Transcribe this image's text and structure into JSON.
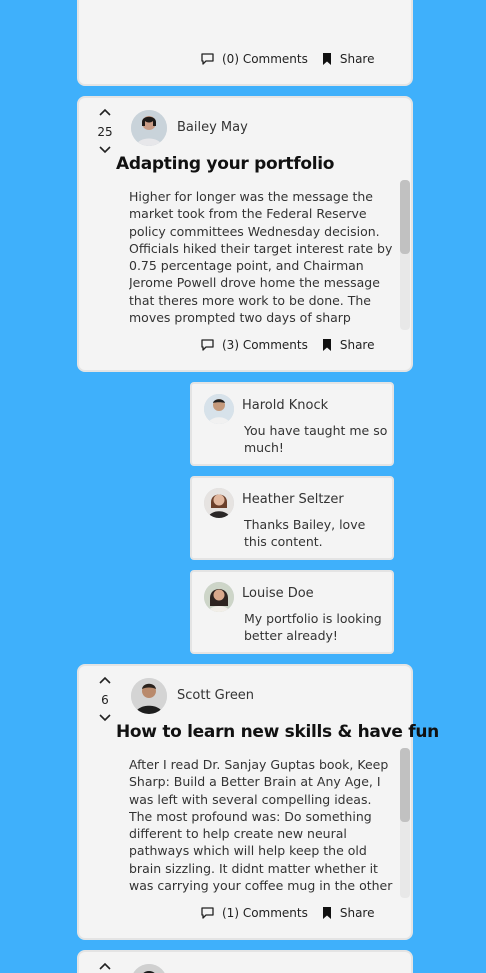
{
  "posts": [
    {
      "comments_label": "(0) Comments",
      "share_label": "Share"
    },
    {
      "score": "25",
      "author": "Bailey May",
      "title": "Adapting your portfolio",
      "body": "Higher for longer was the message the market took from the Federal Reserve policy committees Wednesday decision. Officials hiked their target interest rate by 0.75 percentage point, and Chairman Jerome Powell drove home the message that theres more work to be done. The moves prompted two days of sharp",
      "comments_label": "(3) Comments",
      "share_label": "Share"
    },
    {
      "score": "6",
      "author": "Scott Green",
      "title": "How to learn new skills & have fun",
      "body": "After I read Dr. Sanjay Guptas book, Keep Sharp: Build a Better Brain at Any Age, I was left with several compelling ideas. The most profound was: Do something different to help create new neural pathways which will help keep the old brain sizzling. It didnt matter whether it was carrying your coffee mug in the other",
      "comments_label": "(1) Comments",
      "share_label": "Share"
    }
  ],
  "comments": [
    {
      "author": "Harold Knock",
      "text": "You have taught me so much!"
    },
    {
      "author": "Heather Seltzer",
      "text": "Thanks Bailey, love this content."
    },
    {
      "author": "Louise Doe",
      "text": "My portfolio is looking better already!"
    }
  ],
  "icons": {
    "upvote": "chevron-up-icon",
    "downvote": "chevron-down-icon",
    "comment": "speech-bubble-icon",
    "share": "bookmark-icon"
  },
  "colors": {
    "background": "#3fb0fb",
    "card": "#f4f4f4"
  }
}
